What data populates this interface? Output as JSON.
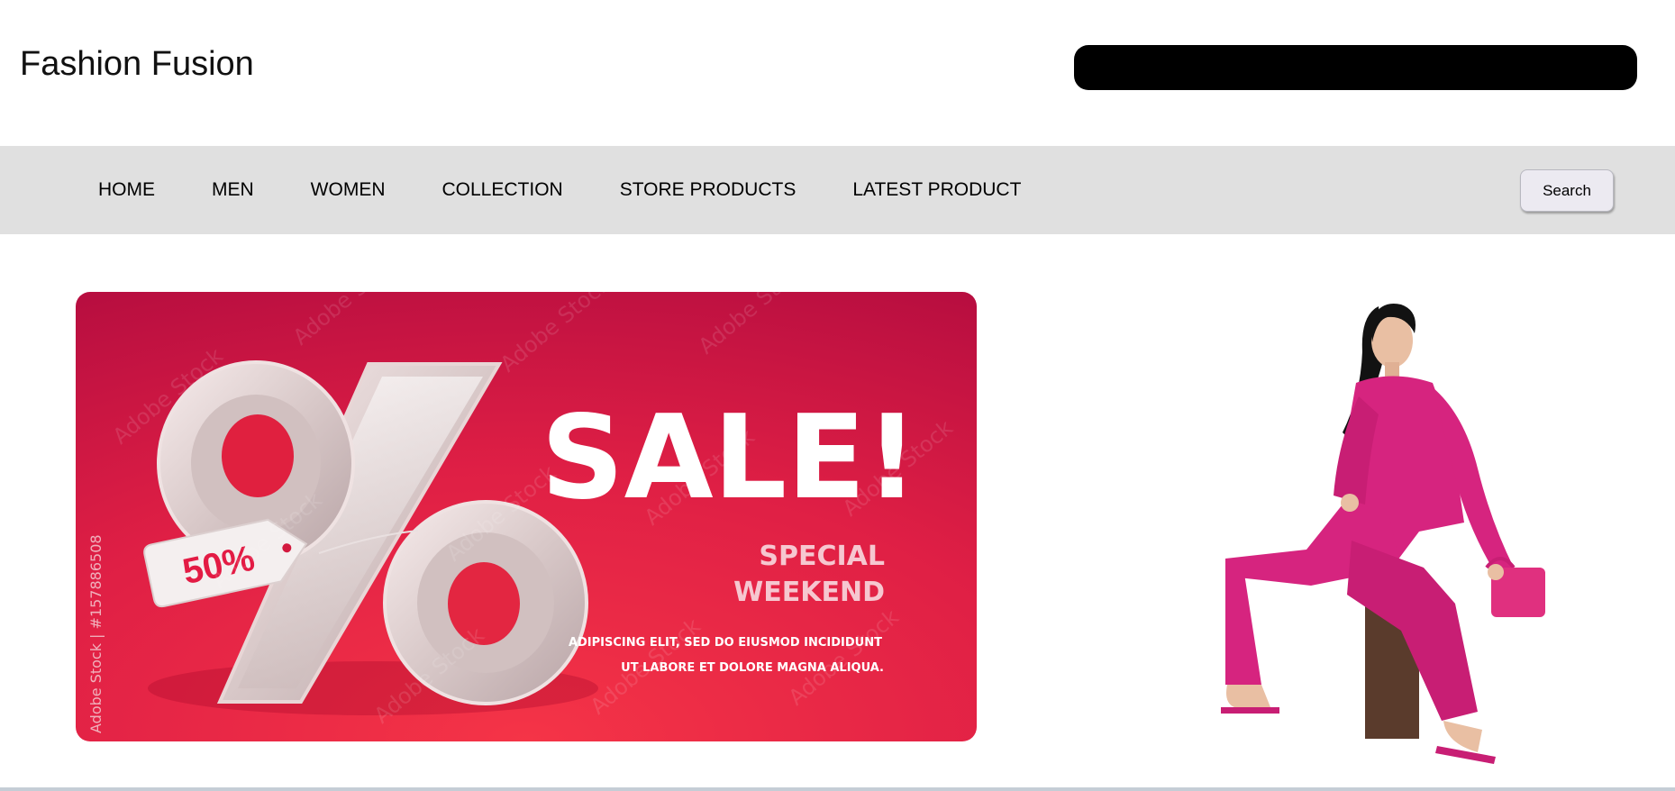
{
  "header": {
    "brand": "Fashion Fusion",
    "search_value": ""
  },
  "nav": {
    "links": [
      "HOME",
      "MEN",
      "WOMEN",
      "COLLECTION",
      "STORE PRODUCTS",
      "LATEST PRODUCT"
    ],
    "search_button": "Search"
  },
  "banner": {
    "headline": "SALE!",
    "tag_text": "50%",
    "subheading_line1": "SPECIAL",
    "subheading_line2": "WEEKEND",
    "body_line1": "ADIPISCING ELIT, SED DO EIUSMOD INCIDIDUNT",
    "body_line2": "UT LABORE ET DOLORE MAGNA ALIQUA.",
    "watermark_side": "Adobe Stock | #157886508",
    "watermark_text": "Adobe Stock",
    "colors": {
      "bg_top": "#c2103e",
      "bg_bottom": "#f22f45",
      "text": "#ffffff",
      "tag_text": "#e31b44"
    }
  },
  "model_image": {
    "icon": "woman-pink-suit-image",
    "colors": {
      "suit": "#d6247f",
      "hair": "#121212",
      "skin": "#e9bfa3"
    }
  }
}
